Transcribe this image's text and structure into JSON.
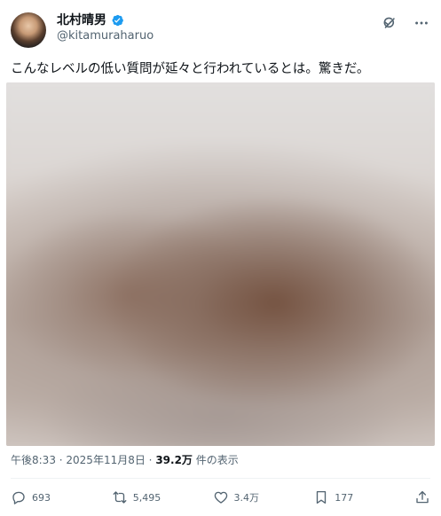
{
  "author": {
    "display_name": "北村晴男",
    "handle": "@kitamuraharuo",
    "verified": true,
    "badge_color": "#1d9bf0"
  },
  "post": {
    "text": "こんなレベルの低い質問が延々と行われているとは。驚きだ。",
    "media": "blurred-photo"
  },
  "meta": {
    "time": "午後8:33",
    "separator": " · ",
    "date": "2025年11月8日",
    "views_count": "39.2万",
    "views_label": " 件の表示"
  },
  "actions": {
    "reply_count": "693",
    "repost_count": "5,495",
    "like_count": "3.4万",
    "bookmark_count": "177"
  },
  "header_icons": [
    "grok-icon",
    "more-icon"
  ],
  "colors": {
    "text_primary": "#0f1419",
    "text_secondary": "#536471",
    "divider": "#eff3f4"
  }
}
